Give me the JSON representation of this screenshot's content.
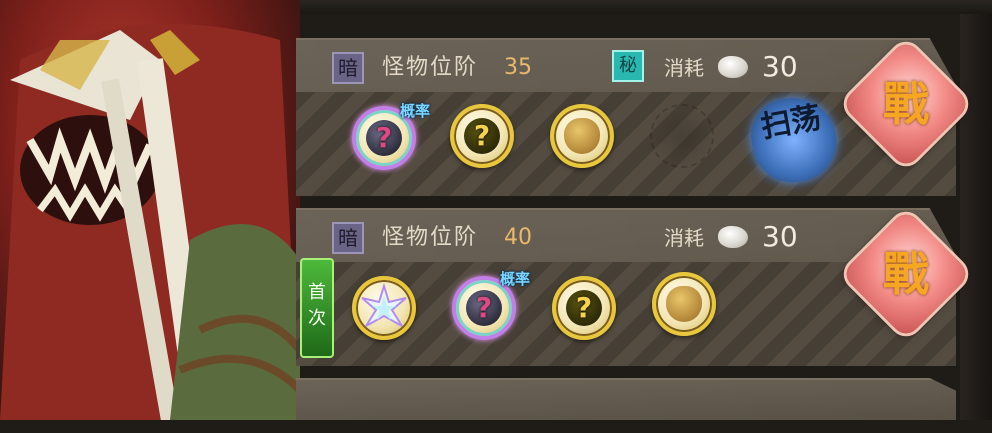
{
  "stages": [
    {
      "dark_badge": "暗",
      "rank_label": "怪物位阶",
      "rank_value": "35",
      "secret_icon": "秘",
      "cost_label": "消耗",
      "cost_value": "30",
      "chance_tag": "概率",
      "sweep_label": "扫荡",
      "battle_label": "戰"
    },
    {
      "dark_badge": "暗",
      "rank_label": "怪物位阶",
      "rank_value": "40",
      "cost_label": "消耗",
      "cost_value": "30",
      "first_badge": "首次",
      "chance_tag": "概率",
      "battle_label": "戰"
    }
  ],
  "icons": {
    "cost": "stamina-egg-icon",
    "reward_rainbow": "rainbow-mystery-orb-icon",
    "reward_gold": "gold-mystery-orb-icon",
    "reward_potion": "potion-bottle-icon",
    "reward_crystal": "crystal-star-icon"
  },
  "colors": {
    "panel": "#5c5346",
    "rank_value": "#e9b96d",
    "secret": "#29b8b0",
    "first_badge": "#2f9e27",
    "battle": "#f28a86"
  }
}
